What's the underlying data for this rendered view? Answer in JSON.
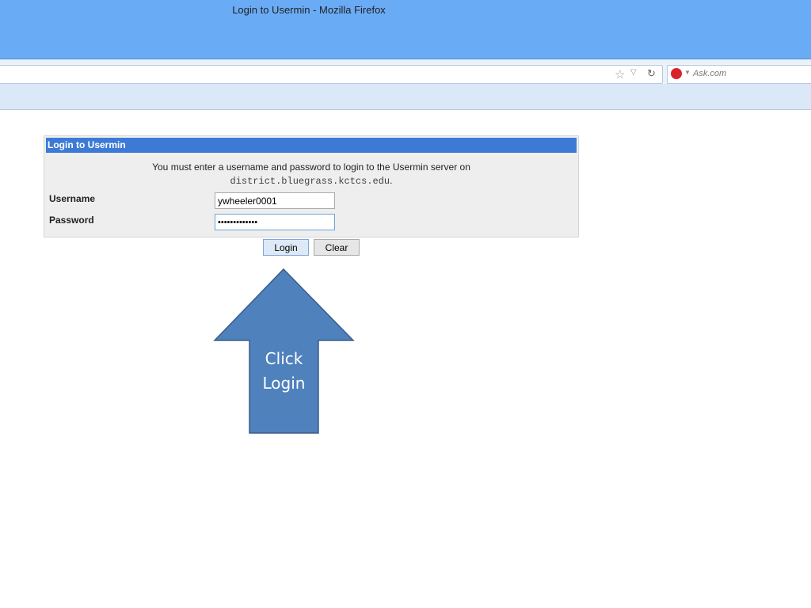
{
  "window": {
    "title": "Login to Usermin - Mozilla Firefox"
  },
  "browser": {
    "search_engine": "Ask.com"
  },
  "login": {
    "header": "Login to Usermin",
    "message": "You must enter a username and password to login to the Usermin server on",
    "server": "district.bluegrass.kctcs.edu",
    "server_suffix": ".",
    "username_label": "Username",
    "username_value": "ywheeler0001",
    "password_label": "Password",
    "password_value": "•••••••••••••",
    "login_button": "Login",
    "clear_button": "Clear"
  },
  "annotation": {
    "line1": "Click",
    "line2": "Login"
  }
}
